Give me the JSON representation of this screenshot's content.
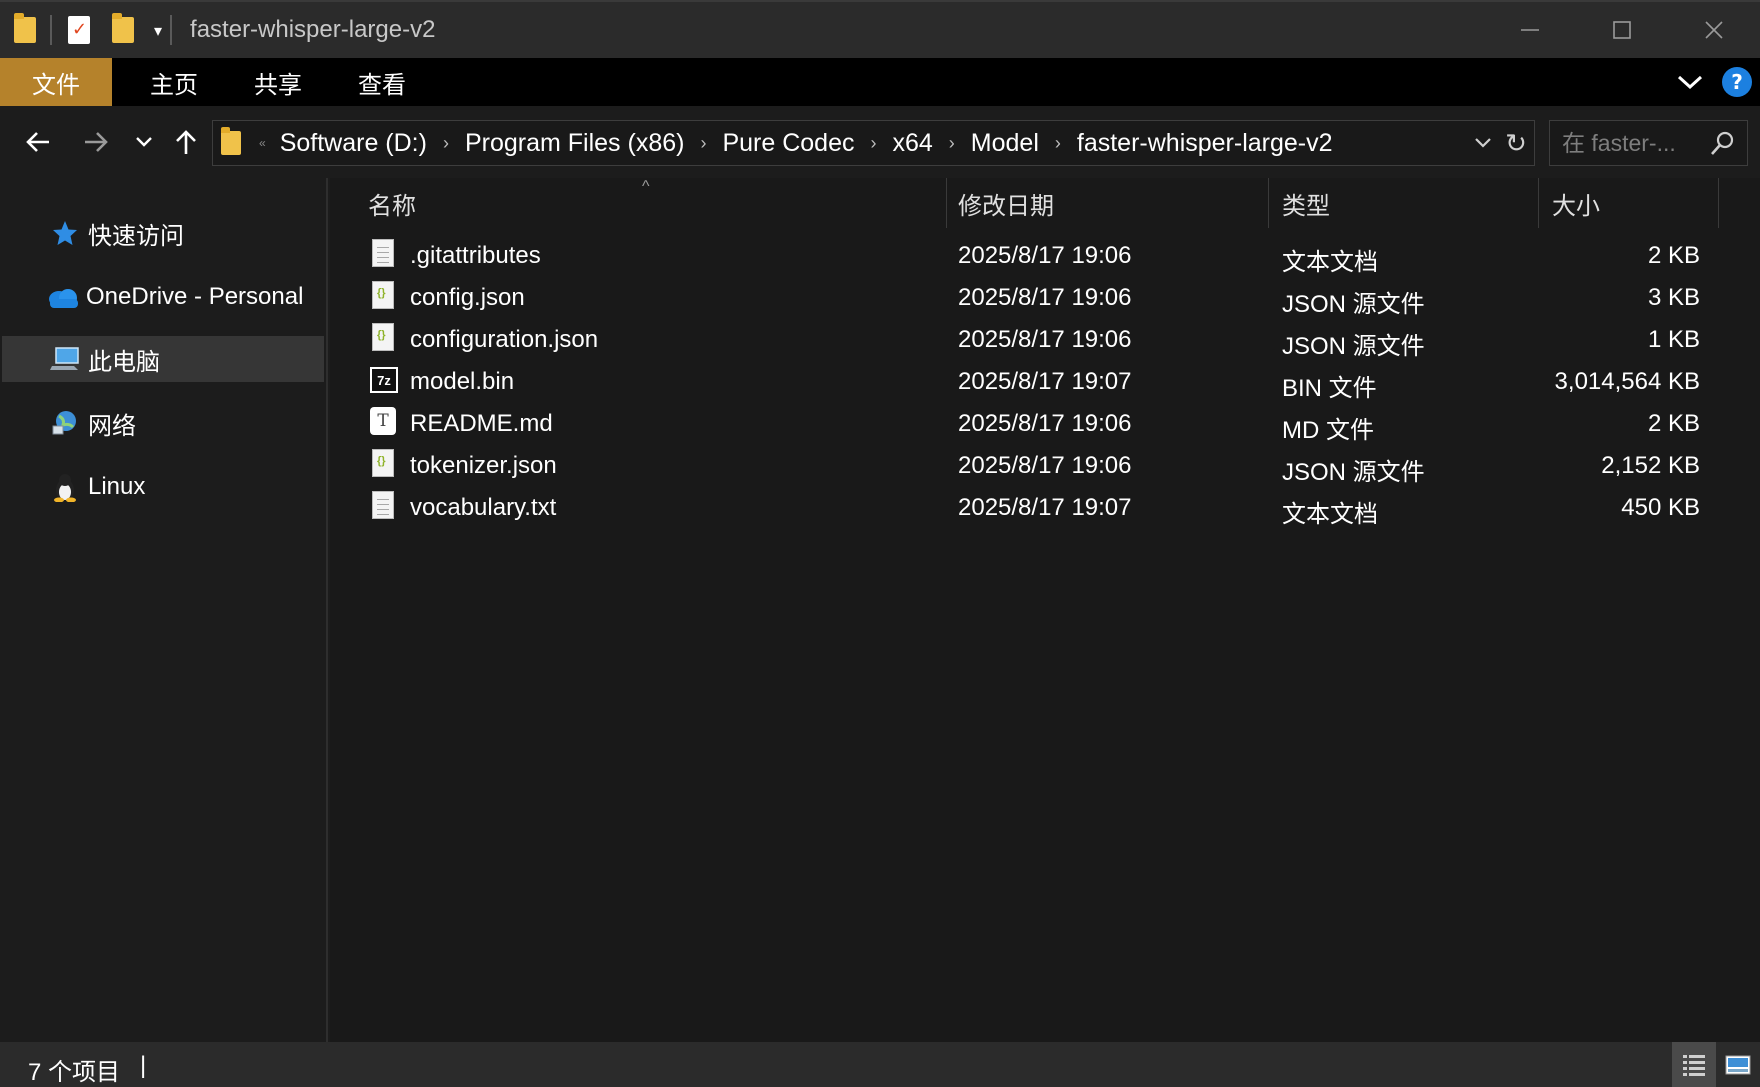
{
  "window": {
    "title": "faster-whisper-large-v2",
    "controls": {
      "minimize": "—",
      "maximize": "☐",
      "close": "✕"
    }
  },
  "quick_access_toolbar": {
    "icons": [
      "folder-icon",
      "properties-icon",
      "new-folder-icon"
    ],
    "dropdown": "▾"
  },
  "ribbon": {
    "tabs": [
      {
        "label": "文件",
        "accent": "#b5822b"
      },
      {
        "label": "主页"
      },
      {
        "label": "共享"
      },
      {
        "label": "查看"
      }
    ],
    "help": "?"
  },
  "address": {
    "breadcrumbs": [
      "Software (D:)",
      "Program Files (x86)",
      "Pure Codec",
      "x64",
      "Model",
      "faster-whisper-large-v2"
    ],
    "lead": "«",
    "separator": "›",
    "refresh": "↻"
  },
  "search": {
    "placeholder": "在 faster-..."
  },
  "sidebar": {
    "items": [
      {
        "label": "快速访问",
        "icon": "star-icon"
      },
      {
        "label": "OneDrive - Personal",
        "icon": "cloud-icon"
      },
      {
        "label": "此电脑",
        "icon": "computer-icon",
        "selected": true
      },
      {
        "label": "网络",
        "icon": "network-icon"
      },
      {
        "label": "Linux",
        "icon": "penguin-icon"
      }
    ]
  },
  "columns": {
    "name": "名称",
    "modified": "修改日期",
    "type": "类型",
    "size": "大小",
    "sort_indicator": "^"
  },
  "files": [
    {
      "name": ".gitattributes",
      "modified": "2025/8/17 19:06",
      "type": "文本文档",
      "size": "2 KB",
      "icon": "text-file-icon"
    },
    {
      "name": "config.json",
      "modified": "2025/8/17 19:06",
      "type": "JSON 源文件",
      "size": "3 KB",
      "icon": "json-file-icon"
    },
    {
      "name": "configuration.json",
      "modified": "2025/8/17 19:06",
      "type": "JSON 源文件",
      "size": "1 KB",
      "icon": "json-file-icon"
    },
    {
      "name": "model.bin",
      "modified": "2025/8/17 19:07",
      "type": "BIN 文件",
      "size": "3,014,564 KB",
      "icon": "7z-file-icon",
      "icon_text": "7z"
    },
    {
      "name": "README.md",
      "modified": "2025/8/17 19:06",
      "type": "MD 文件",
      "size": "2 KB",
      "icon": "markdown-file-icon",
      "icon_text": "T"
    },
    {
      "name": "tokenizer.json",
      "modified": "2025/8/17 19:06",
      "type": "JSON 源文件",
      "size": "2,152 KB",
      "icon": "json-file-icon"
    },
    {
      "name": "vocabulary.txt",
      "modified": "2025/8/17 19:07",
      "type": "文本文档",
      "size": "450 KB",
      "icon": "text-file-icon"
    }
  ],
  "status": {
    "item_count": "7 个项目",
    "separator": "|"
  }
}
